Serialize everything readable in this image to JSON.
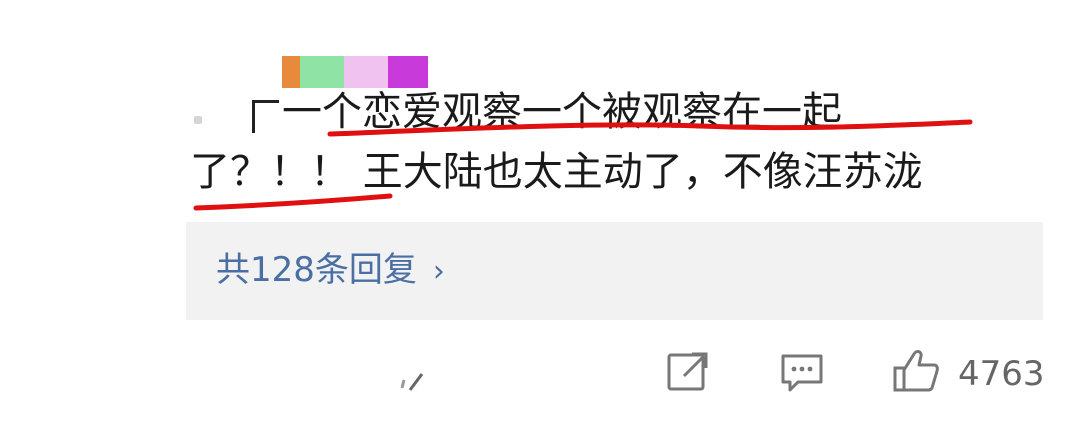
{
  "comment": {
    "line1": "一个恋爱观察一个被观察在一起",
    "line2": "了？！！ 王大陆也太主动了，不像汪苏泷"
  },
  "replies": {
    "label": "共128条回复",
    "chevron": "›"
  },
  "actions": {
    "share_icon": "share-icon",
    "comment_icon": "comment-icon",
    "like_icon": "thumbs-up-icon",
    "like_count": "4763"
  },
  "colors": {
    "text": "#1a1a1a",
    "link": "#4a6fa5",
    "reply_bg": "#f2f2f2",
    "underline": "#e01010",
    "icon": "#777777"
  }
}
